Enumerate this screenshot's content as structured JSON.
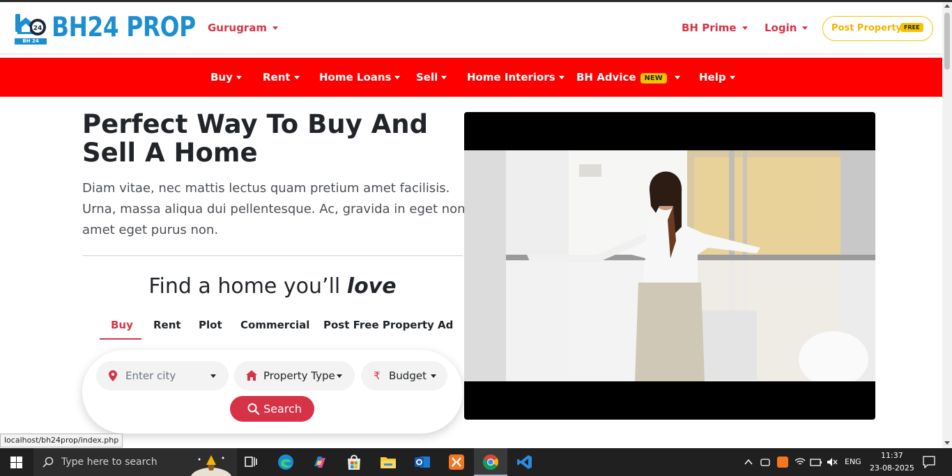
{
  "brand": {
    "name": "BH24 PROP",
    "subtext": "BH 24 PROP",
    "color": "#1d8fd0"
  },
  "header": {
    "city": "Gurugram",
    "bh_prime": "BH Prime",
    "login": "Login",
    "post_property": "Post Property",
    "free_badge": "FREE"
  },
  "nav": {
    "items": [
      "Buy",
      "Rent",
      "Home Loans",
      "Sell",
      "Home Interiors",
      "BH Advice",
      "Help"
    ],
    "new_badge": "NEW",
    "bg_color": "#ff0000"
  },
  "hero": {
    "title": "Perfect Way To Buy And Sell A Home",
    "description": "Diam vitae, nec mattis lectus quam pretium amet facilisis. Urna, massa aliqua dui pellentesque. Ac, gravida in eget non amet eget purus non."
  },
  "finder": {
    "heading_prefix": "Find a home you’ll ",
    "heading_emphasis": "love",
    "tabs": [
      "Buy",
      "Rent",
      "Plot",
      "Commercial",
      "Post Free Property Ad"
    ],
    "active_tab": "Buy",
    "city_placeholder": "Enter city",
    "property_type": "Property Type",
    "budget": "Budget",
    "rupee_symbol": "₹",
    "search_button": "Search",
    "accent_color": "#d63347"
  },
  "status_tip": "localhost/bh24prop/index.php",
  "taskbar": {
    "search_placeholder": "Type here to search",
    "language": "ENG",
    "time": "11:37",
    "date": "23-08-2025",
    "apps": [
      "task-view",
      "edge",
      "copilot",
      "store",
      "file-explorer",
      "outlook",
      "xampp",
      "chrome",
      "vscode"
    ],
    "active_app": "chrome"
  }
}
